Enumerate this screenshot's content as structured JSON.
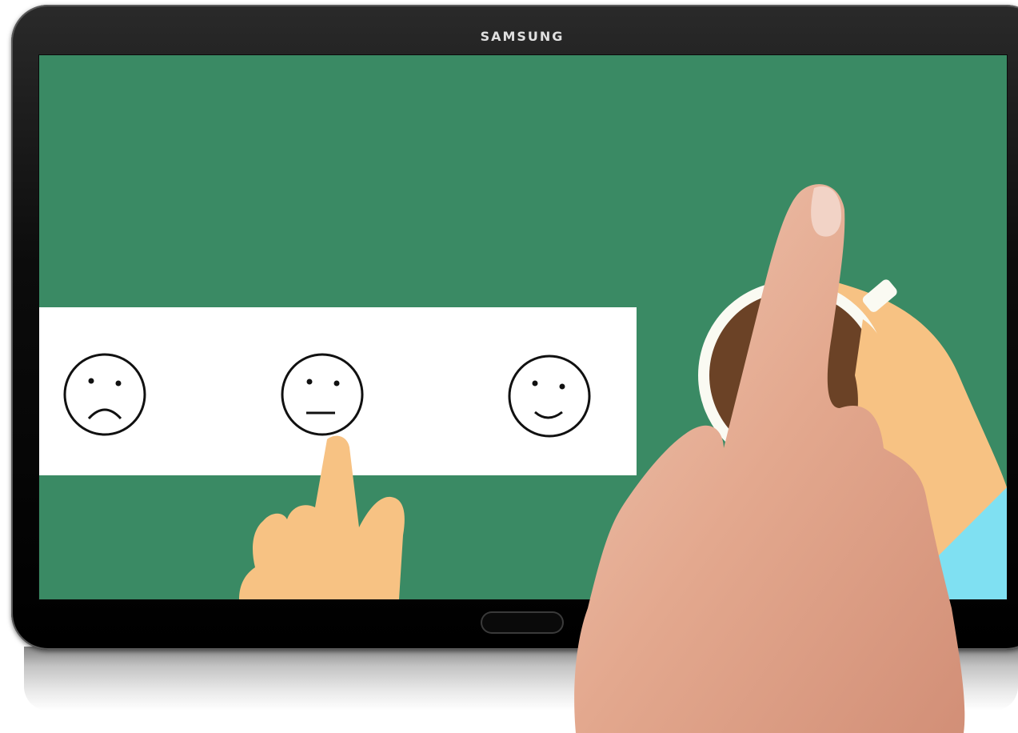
{
  "device": {
    "brand": "SAMSUNG"
  },
  "colors": {
    "screen_background": "#3a8a64",
    "rating_strip": "#ffffff",
    "skin_illustration": "#f7c283",
    "coffee": "#6b4226",
    "sleeve": "#7fe0f2"
  },
  "rating": {
    "options": [
      "sad-face",
      "neutral-face",
      "happy-face"
    ],
    "selected": "neutral-face"
  }
}
